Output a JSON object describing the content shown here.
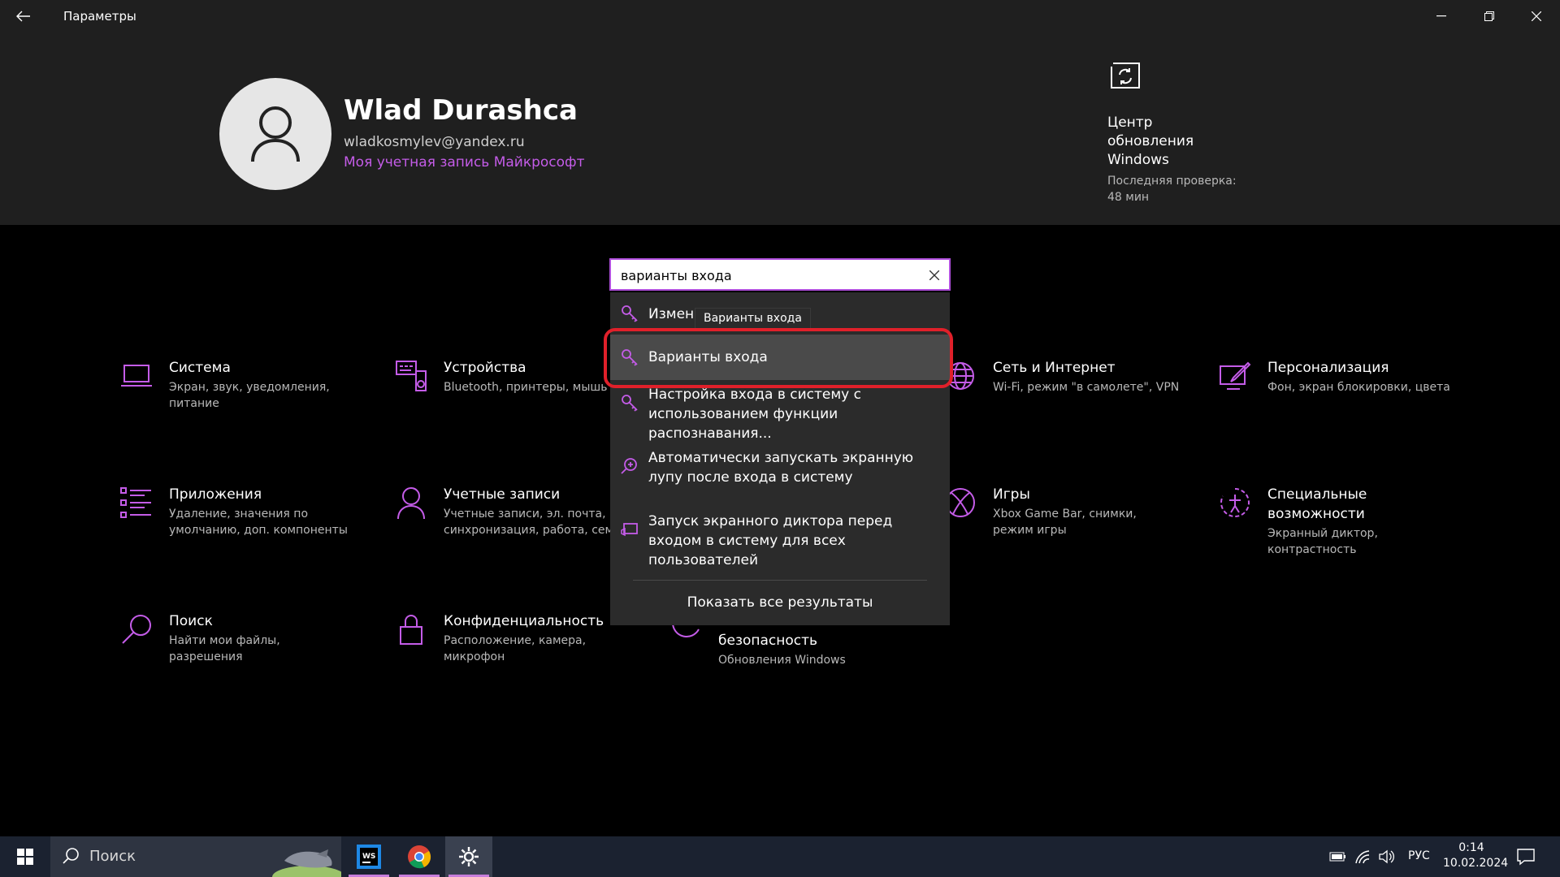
{
  "window": {
    "title": "Параметры"
  },
  "user": {
    "name": "Wlad Durashca",
    "email": "wladkosmylev@yandex.ru",
    "account_link": "Моя учетная запись Майкрософт"
  },
  "update": {
    "title": "Центр обновления Windows",
    "subtitle": "Последняя проверка: 48 мин"
  },
  "search": {
    "value": "варианты входа",
    "tooltip": "Варианты входа",
    "results": [
      {
        "text": "Изменить"
      },
      {
        "text": "Варианты входа"
      },
      {
        "text": "Настройка входа в систему с использованием функции распознавания..."
      },
      {
        "text": "Автоматически запускать экранную лупу после входа в систему"
      },
      {
        "text": "Запуск экранного диктора перед входом в систему для всех пользователей"
      }
    ],
    "show_all": "Показать все результаты"
  },
  "tiles": [
    {
      "title": "Система",
      "desc": "Экран, звук, уведомления, питание"
    },
    {
      "title": "Устройства",
      "desc": "Bluetooth, принтеры, мышь"
    },
    {
      "title": "Сеть и Интернет",
      "desc": "Wi-Fi, режим \"в самолете\", VPN"
    },
    {
      "title": "Персонализация",
      "desc": "Фон, экран блокировки, цвета"
    },
    {
      "title": "Приложения",
      "desc": "Удаление, значения по умолчанию, доп. компоненты"
    },
    {
      "title": "Учетные записи",
      "desc": "Учетные записи, эл. почта, синхронизация, работа, семья"
    },
    {
      "title": "Игры",
      "desc": "Xbox Game Bar, снимки, режим игры"
    },
    {
      "title": "Специальные возможности",
      "desc": "Экранный диктор, контрастность"
    },
    {
      "title": "Поиск",
      "desc": "Найти мои файлы, разрешения"
    },
    {
      "title": "Конфиденциальность",
      "desc": "Расположение, камера, микрофон"
    },
    {
      "title": "безопасность",
      "desc": "Обновления Windows"
    }
  ],
  "taskbar": {
    "search_placeholder": "Поиск",
    "lang": "РУС",
    "time": "0:14",
    "date": "10.02.2024"
  },
  "colors": {
    "accent": "#c45ce8",
    "highlight": "#e0202a"
  }
}
